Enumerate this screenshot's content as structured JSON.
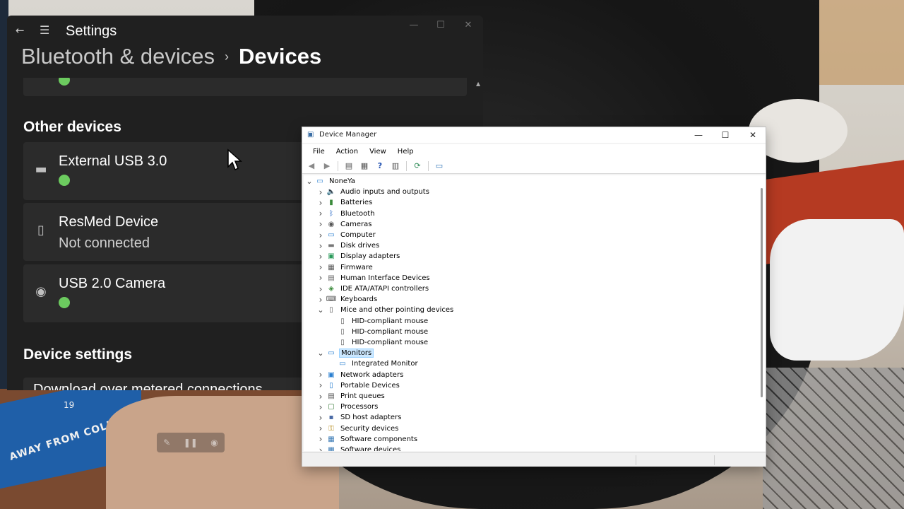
{
  "settings": {
    "app_title": "Settings",
    "breadcrumb": {
      "parent": "Bluetooth & devices",
      "separator": "›",
      "current": "Devices"
    },
    "other_devices": {
      "heading": "Other devices",
      "items": [
        {
          "name": "External USB 3.0",
          "status": "",
          "icon": "usb-drive-icon"
        },
        {
          "name": "ResMed Device",
          "status": "Not connected",
          "icon": "generic-device-icon"
        },
        {
          "name": "USB 2.0 Camera",
          "status": "",
          "icon": "webcam-icon"
        }
      ]
    },
    "device_settings": {
      "heading": "Device settings",
      "row_label": "Download over metered connections"
    },
    "colors": {
      "connected": "#6ccb5f",
      "background": "#202020",
      "card": "#2b2b2b"
    }
  },
  "device_manager": {
    "title": "Device Manager",
    "menu": [
      "File",
      "Action",
      "View",
      "Help"
    ],
    "toolbar": [
      "back-icon",
      "forward-icon",
      "show-hide-console-tree-icon",
      "properties-icon",
      "help-icon",
      "show-action-pane-icon",
      "update-driver-icon",
      "scan-hardware-icon"
    ],
    "tree": {
      "root": "NoneYa",
      "items": [
        {
          "label": "Audio inputs and outputs",
          "icon": "speaker-icon",
          "expanded": false
        },
        {
          "label": "Batteries",
          "icon": "battery-icon",
          "expanded": false
        },
        {
          "label": "Bluetooth",
          "icon": "bluetooth-icon",
          "expanded": false
        },
        {
          "label": "Cameras",
          "icon": "camera-icon",
          "expanded": false
        },
        {
          "label": "Computer",
          "icon": "computer-icon",
          "expanded": false
        },
        {
          "label": "Disk drives",
          "icon": "disk-drive-icon",
          "expanded": false
        },
        {
          "label": "Display adapters",
          "icon": "display-adapter-icon",
          "expanded": false
        },
        {
          "label": "Firmware",
          "icon": "firmware-icon",
          "expanded": false
        },
        {
          "label": "Human Interface Devices",
          "icon": "hid-icon",
          "expanded": false
        },
        {
          "label": "IDE ATA/ATAPI controllers",
          "icon": "ide-controller-icon",
          "expanded": false
        },
        {
          "label": "Keyboards",
          "icon": "keyboard-icon",
          "expanded": false
        },
        {
          "label": "Mice and other pointing devices",
          "icon": "mouse-icon",
          "expanded": true,
          "children": [
            "HID-compliant mouse",
            "HID-compliant mouse",
            "HID-compliant mouse"
          ]
        },
        {
          "label": "Monitors",
          "icon": "monitor-icon",
          "expanded": true,
          "selected": true,
          "children": [
            "Integrated Monitor"
          ]
        },
        {
          "label": "Network adapters",
          "icon": "network-adapter-icon",
          "expanded": false
        },
        {
          "label": "Portable Devices",
          "icon": "portable-device-icon",
          "expanded": false
        },
        {
          "label": "Print queues",
          "icon": "printer-icon",
          "expanded": false
        },
        {
          "label": "Processors",
          "icon": "processor-icon",
          "expanded": false
        },
        {
          "label": "SD host adapters",
          "icon": "sd-card-icon",
          "expanded": false
        },
        {
          "label": "Security devices",
          "icon": "security-device-icon",
          "expanded": false
        },
        {
          "label": "Software components",
          "icon": "software-component-icon",
          "expanded": false
        },
        {
          "label": "Software devices",
          "icon": "software-device-icon",
          "expanded": false
        }
      ]
    }
  },
  "background": {
    "mat_text": "AWAY FROM COLD",
    "mat_number": "19"
  }
}
